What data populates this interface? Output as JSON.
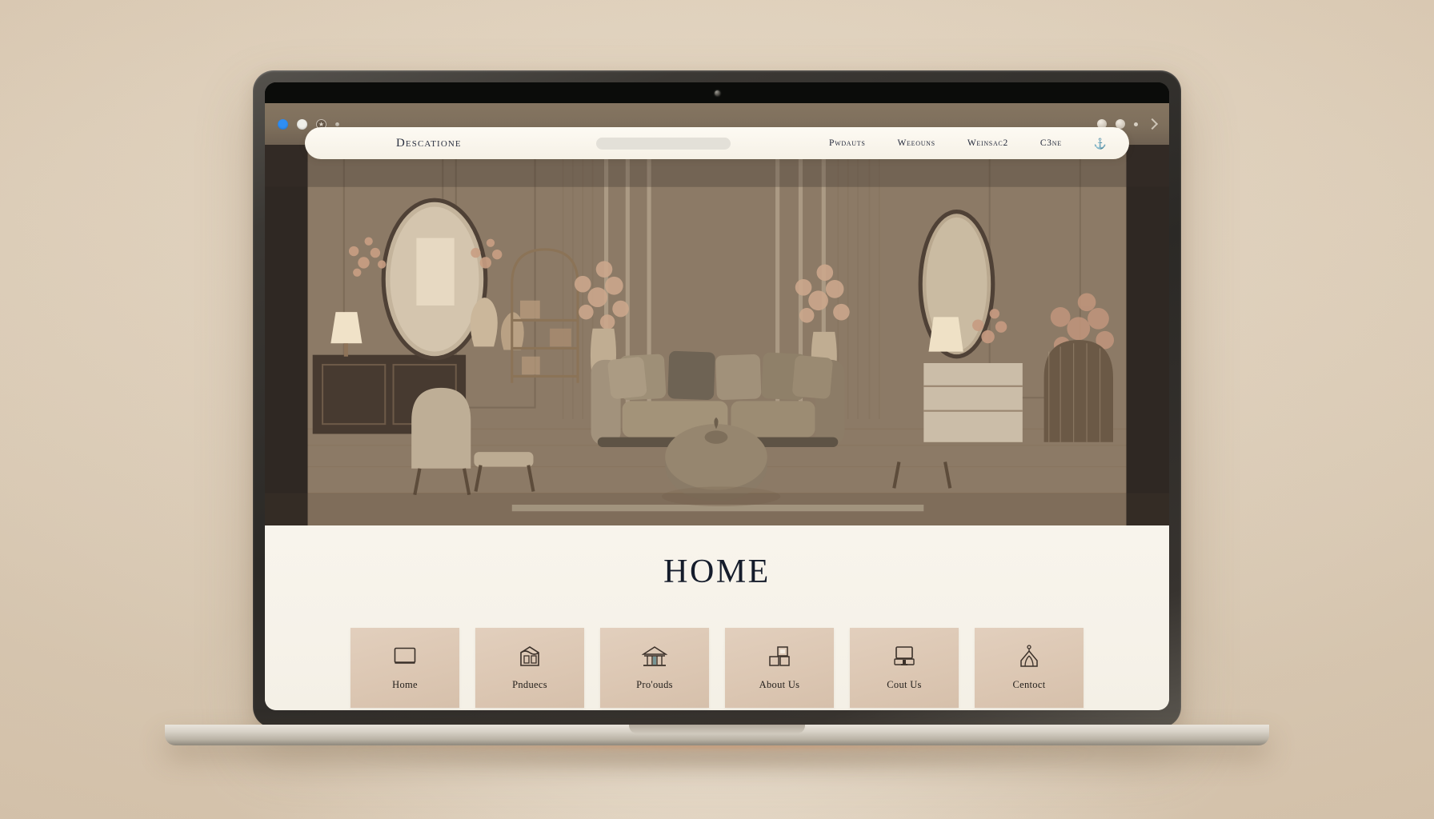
{
  "browser": {
    "window_controls": [
      "blue-dot",
      "grey-dot",
      "shield-badge",
      "tiny-dot"
    ],
    "right_controls": [
      "profile-dot",
      "menu-dot",
      "small-dot",
      "chevron"
    ]
  },
  "site": {
    "brand": "Descatione",
    "search_placeholder": "",
    "nav_links": [
      {
        "label": "Pwdauts"
      },
      {
        "label": "Weeouns"
      },
      {
        "label": "Weinsac2"
      },
      {
        "label": "C3ne"
      }
    ],
    "nav_icon": "⚓"
  },
  "hero": {
    "alt": "Warm beige interior living room with sofa, ottoman, arched mirror, shelving and dried floral arrangements"
  },
  "page": {
    "title": "HOME",
    "cards": [
      {
        "label": "Home",
        "icon": "window-frame-icon",
        "blurb": [
          "line",
          "line",
          "line"
        ]
      },
      {
        "label": "Pnduecs",
        "icon": "storefront-icon",
        "blurb": [
          "line",
          "line",
          "line"
        ]
      },
      {
        "label": "Pro'ouds",
        "icon": "classical-building-icon",
        "blurb": [
          "line",
          "line",
          "line"
        ]
      },
      {
        "label": "About Us",
        "icon": "blocks-grid-icon",
        "blurb": [
          "line",
          "line",
          "line"
        ]
      },
      {
        "label": "Cout Us",
        "icon": "desktop-monitor-icon",
        "blurb": [
          "line",
          "line",
          "line"
        ]
      },
      {
        "label": "Centoct",
        "icon": "pavilion-icon",
        "blurb": [
          "line",
          "line",
          "line"
        ]
      }
    ]
  },
  "colors": {
    "backdrop": "#e3d5c1",
    "chrome": "#7e6f5c",
    "navbar": "#fdfaf3",
    "content_bg": "#f7f3ea",
    "card_bg": "#dcc7b3",
    "title_text": "#151c2b",
    "accent_glow": "#e27838"
  }
}
